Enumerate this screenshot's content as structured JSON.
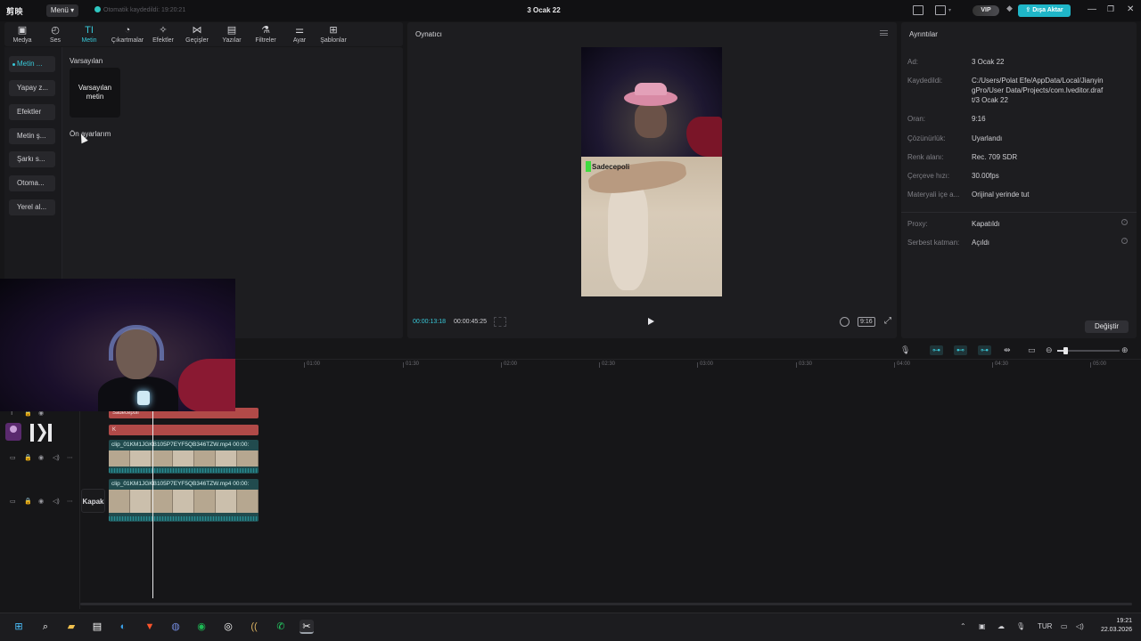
{
  "titlebar": {
    "logo": "剪映",
    "menu_label": "Menü",
    "autosave_text": "Otomatik kaydedildi: 19:20:21",
    "project_title": "3 Ocak 22",
    "vip_label": "VIP",
    "export_label": "Dışa Aktar"
  },
  "toolbar": {
    "items": [
      {
        "label": "Medya",
        "icon": "media-icon"
      },
      {
        "label": "Ses",
        "icon": "audio-icon"
      },
      {
        "label": "Metin",
        "icon": "text-icon"
      },
      {
        "label": "Çıkartmalar",
        "icon": "sticker-icon"
      },
      {
        "label": "Efektler",
        "icon": "effects-icon"
      },
      {
        "label": "Geçişler",
        "icon": "transitions-icon"
      },
      {
        "label": "Yazılar",
        "icon": "captions-icon"
      },
      {
        "label": "Filtreler",
        "icon": "filters-icon"
      },
      {
        "label": "Ayar",
        "icon": "adjust-icon"
      },
      {
        "label": "Şablonlar",
        "icon": "templates-icon"
      }
    ],
    "active_index": 2
  },
  "sidebar": {
    "items": [
      "Metin ...",
      "Yapay z...",
      "Efektler",
      "Metin ş...",
      "Şarkı s...",
      "Otoma...",
      "Yerel al..."
    ]
  },
  "library": {
    "section_default": "Varsayılan",
    "card_label": "Varsayılan metin",
    "section_presets": "Ön ayarlarım"
  },
  "player": {
    "title": "Oynatıcı",
    "current_time": "00:00:13:18",
    "total_time": "00:00:45:25",
    "ratio_badge": "9:16",
    "watermark": "Sadecepoli"
  },
  "details": {
    "title": "Ayrıntılar",
    "rows": [
      {
        "label": "Ad:",
        "value": "3 Ocak 22"
      },
      {
        "label": "Kaydedildi:",
        "value": "C:/Users/Polat Efe/AppData/Local/JianyingPro/User Data/Projects/com.lveditor.draft/3 Ocak 22"
      },
      {
        "label": "Oran:",
        "value": "9:16"
      },
      {
        "label": "Çözünürlük:",
        "value": "Uyarlandı"
      },
      {
        "label": "Renk alanı:",
        "value": "Rec. 709 SDR"
      },
      {
        "label": "Çerçeve hızı:",
        "value": "30.00fps"
      },
      {
        "label": "Materyali içe a...",
        "value": "Orijinal yerinde tut"
      },
      {
        "label": "Proxy:",
        "value": "Kapatıldı"
      },
      {
        "label": "Serbest katman:",
        "value": "Açıldı"
      }
    ],
    "change_label": "Değiştir"
  },
  "timeline": {
    "ruler": [
      "01:00",
      "01:30",
      "02:00",
      "02:30",
      "03:00",
      "03:30",
      "04:00",
      "04:30",
      "05:00"
    ],
    "text_clips": [
      "Sadecepoli",
      "K"
    ],
    "video_clip_name": "clip_01KM1JGKB105P7EYF5QB346TZW.mp4",
    "video_clip_duration": "00:00:",
    "cover_label": "Kapak"
  },
  "taskbar": {
    "language": "TUR",
    "time": "19:21",
    "date": "22.03.2026"
  },
  "colors": {
    "accent": "#38c8d8",
    "export": "#1fb6c8",
    "text_clip": "#b14a48",
    "video_clip": "#214b4e"
  }
}
